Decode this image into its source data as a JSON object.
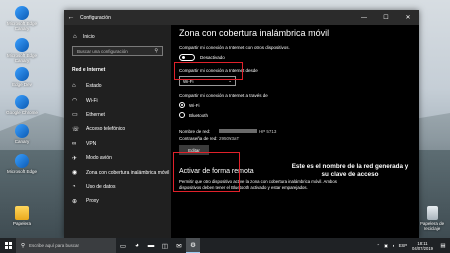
{
  "desktop_icons": [
    {
      "label": "Microsoft Edge Canary",
      "kind": "edge"
    },
    {
      "label": "Microsoft Edge Canary",
      "kind": "edge"
    },
    {
      "label": "Edge Dev",
      "kind": "edge"
    },
    {
      "label": "Google Chrome",
      "kind": "edge"
    },
    {
      "label": "Canary",
      "kind": "edge"
    },
    {
      "label": "Microsoft Edge",
      "kind": "edge"
    },
    {
      "label": "Papelera",
      "kind": "folder"
    },
    {
      "label": "Papelera de reciclaje",
      "kind": "bin"
    }
  ],
  "window": {
    "title": "Configuración",
    "back_icon": "back-arrow-icon",
    "controls": {
      "minimize": "—",
      "maximize": "☐",
      "close": "✕"
    }
  },
  "sidebar": {
    "home": "Inicio",
    "search_placeholder": "Buscar una configuración",
    "section": "Red e Internet",
    "items": [
      {
        "label": "Estado",
        "icon": "⌂"
      },
      {
        "label": "Wi-Fi",
        "icon": "◠"
      },
      {
        "label": "Ethernet",
        "icon": "▭"
      },
      {
        "label": "Acceso telefónico",
        "icon": "☏"
      },
      {
        "label": "VPN",
        "icon": "∞"
      },
      {
        "label": "Modo avión",
        "icon": "✈"
      },
      {
        "label": "Zona con cobertura inalámbrica móvil",
        "icon": "◉"
      },
      {
        "label": "Uso de datos",
        "icon": "◔"
      },
      {
        "label": "Proxy",
        "icon": "⊕"
      }
    ]
  },
  "main": {
    "title": "Zona con cobertura inalámbrica móvil",
    "share_label": "Compartir mi conexión a Internet con otros dispositivos.",
    "toggle_state": "Desactivado",
    "share_from_label": "Compartir mi conexión a Internet desde",
    "share_from_value": "Wi-Fi",
    "share_via_label": "Compartir mi conexión a Internet a través de",
    "radio_options": [
      {
        "label": "Wi-Fi",
        "selected": true
      },
      {
        "label": "Bluetooth",
        "selected": false
      }
    ],
    "network_name_label": "Nombre de red:",
    "network_name_value": "HP 5713",
    "password_label": "Contraseña de red:",
    "password_value": "2950¥3aT",
    "edit_button": "Editar",
    "annotation": "Este es el nombre de la red generada y su clave de acceso",
    "remote_title": "Activar de forma remota",
    "remote_desc": "Permitir que otro dispositivo active la zona con cobertura inalámbrica móvil. Ambos dispositivos deben tener el Bluetooth activado y estar emparejados."
  },
  "taskbar": {
    "search_placeholder": "Escribe aquí para buscar",
    "tray_lang": "ESP",
    "time": "18:11",
    "date": "04/07/2019"
  },
  "colors": {
    "highlight": "#e0212a",
    "accent": "#9ccbf0"
  }
}
